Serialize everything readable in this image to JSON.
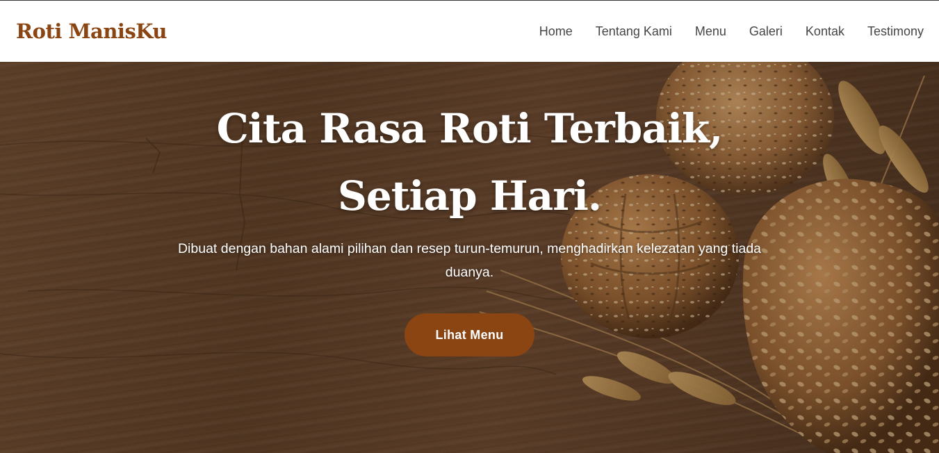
{
  "brand": {
    "name": "Roti ManisKu"
  },
  "nav": {
    "items": [
      {
        "label": "Home"
      },
      {
        "label": "Tentang Kami"
      },
      {
        "label": "Menu"
      },
      {
        "label": "Galeri"
      },
      {
        "label": "Kontak"
      },
      {
        "label": "Testimony"
      }
    ]
  },
  "hero": {
    "title": "Cita Rasa Roti Terbaik, Setiap Hari.",
    "subtitle": "Dibuat dengan bahan alami pilihan dan resep turun-temurun, menghadirkan kelezatan yang tiada duanya.",
    "cta_label": "Lihat Menu",
    "image_alt": "bread-and-wheat-on-wooden-table"
  },
  "colors": {
    "brand": "#8b4513",
    "nav_text": "#444444",
    "hero_text": "#ffffff",
    "button_bg": "#8b4513"
  }
}
